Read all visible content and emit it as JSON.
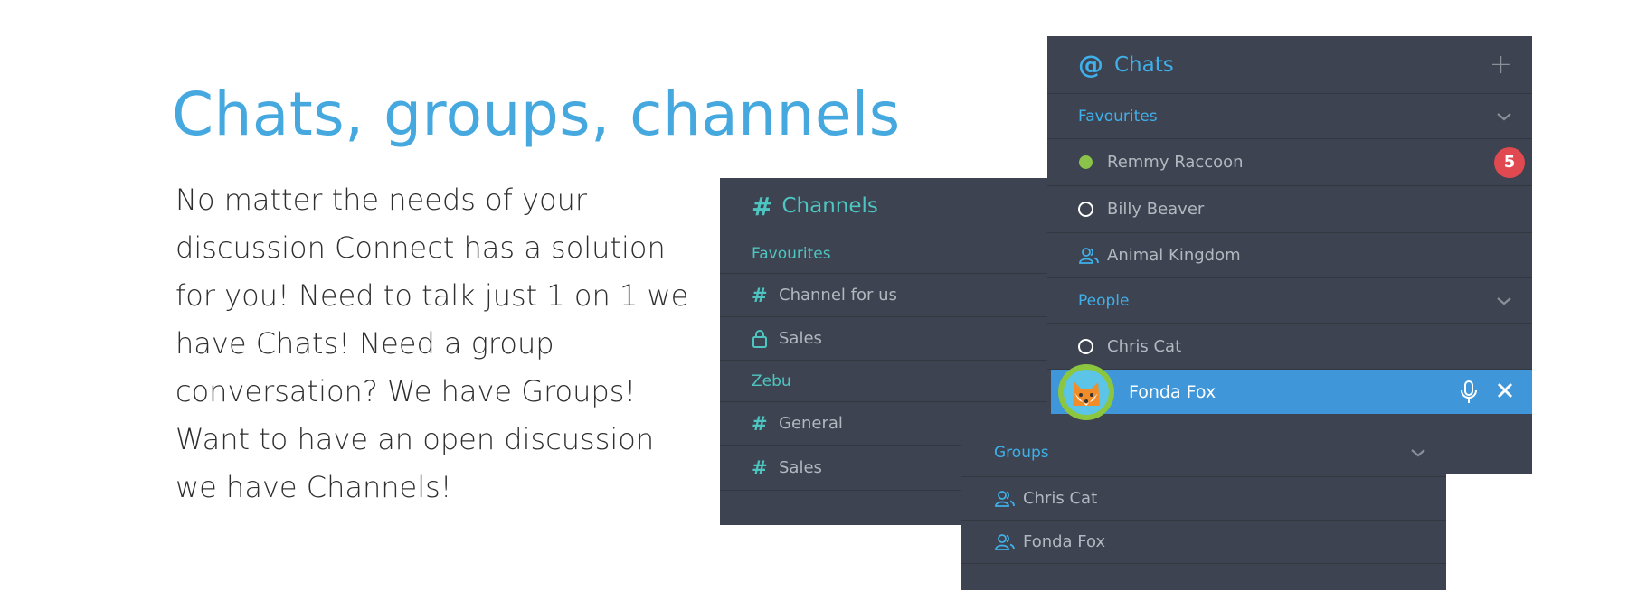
{
  "intro": {
    "title": "Chats, groups, channels",
    "lines": [
      "No matter the needs of your",
      "discussion Connect has a solution",
      "for you! Need to talk just 1 on 1 we",
      "have Chats! Need a group",
      "conversation? We have Groups!",
      "Want to have an open discussion",
      "we have Channels!"
    ]
  },
  "channels_panel": {
    "title": "Channels",
    "sections": [
      {
        "label": "Favourites",
        "items": [
          {
            "label": "Channel for us",
            "icon": "hash-icon"
          },
          {
            "label": "Sales",
            "icon": "lock-icon"
          }
        ]
      },
      {
        "label": "Zebu",
        "items": [
          {
            "label": "General",
            "icon": "hash-icon"
          },
          {
            "label": "Sales",
            "icon": "hash-icon"
          }
        ]
      }
    ]
  },
  "chats_panel": {
    "title": "Chats",
    "favourites": {
      "label": "Favourites",
      "items": [
        {
          "label": "Remmy Raccoon",
          "status": "online",
          "badge": "5"
        },
        {
          "label": "Billy Beaver",
          "status": "offline"
        },
        {
          "label": "Animal Kingdom",
          "icon": "group-icon"
        }
      ]
    },
    "people": {
      "label": "People",
      "items": [
        {
          "label": "Chris Cat",
          "status": "offline"
        },
        {
          "label": "Fonda Fox",
          "selected": true
        }
      ]
    }
  },
  "groups_panel": {
    "label": "Groups",
    "items": [
      {
        "label": "Chris Cat",
        "icon": "group-icon"
      },
      {
        "label": "Fonda Fox",
        "icon": "group-icon"
      }
    ]
  },
  "colors": {
    "title_blue": "#45a8de",
    "panel_bg": "#3d4350",
    "channel_teal": "#4dc6c1",
    "chat_blue": "#3fb0ea",
    "selected_bg": "#3f97d9",
    "badge_red": "#e0494f",
    "online_green": "#8bc34a"
  }
}
